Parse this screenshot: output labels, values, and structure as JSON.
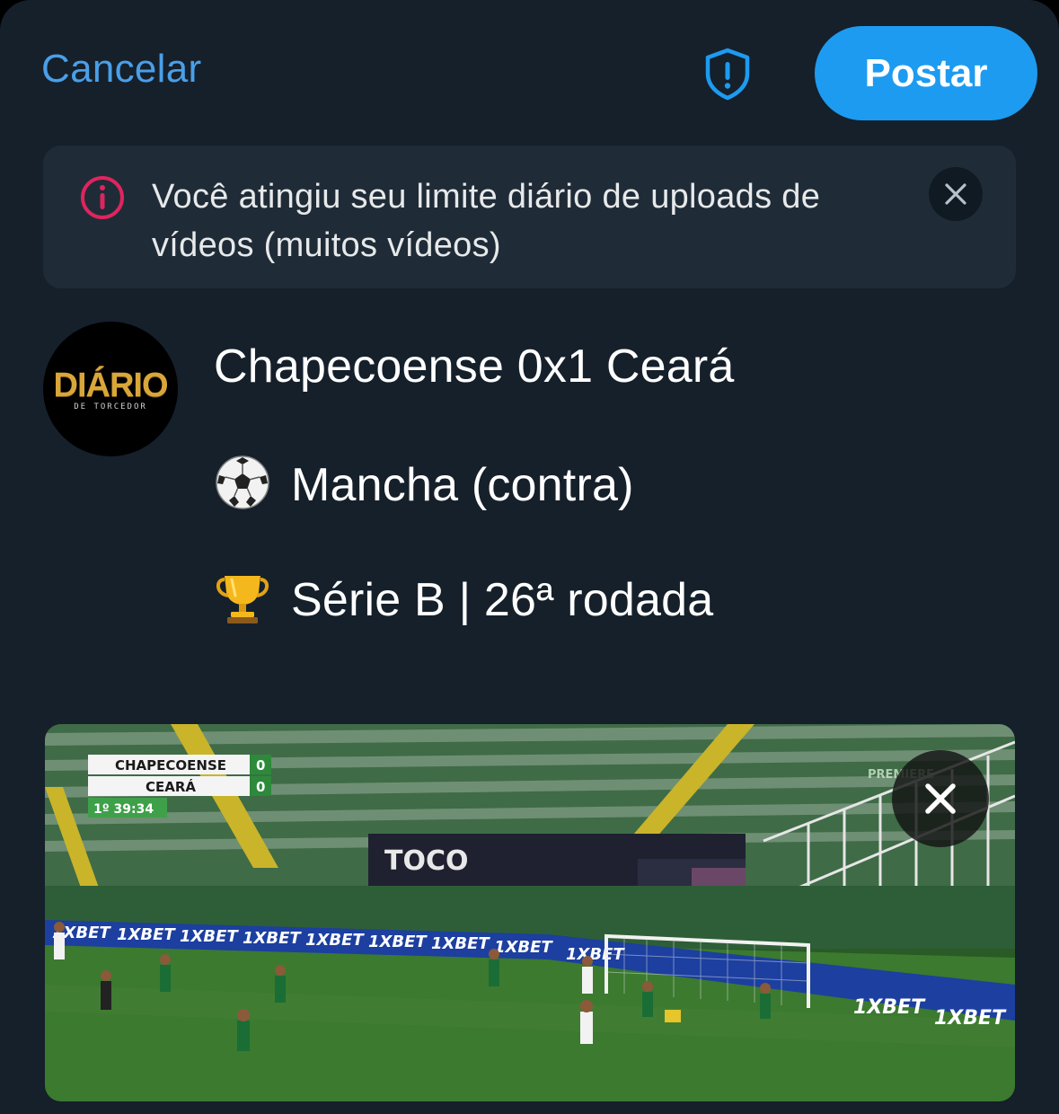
{
  "header": {
    "cancel_label": "Cancelar",
    "post_label": "Postar"
  },
  "banner": {
    "message": "Você atingiu seu limite diário de uploads de vídeos (muitos vídeos)"
  },
  "avatar": {
    "logo_text": "DIÁRIO",
    "logo_sub": "DE TORCEDOR"
  },
  "post": {
    "line1": "Chapecoense 0x1 Ceará",
    "line2": "Mancha (contra)",
    "line3": "Série B | 26ª rodada",
    "line2_icon": "soccer-ball-icon",
    "line3_icon": "trophy-icon"
  },
  "media": {
    "scoreboard": {
      "home_team": "CHAPECOENSE",
      "home_score": "0",
      "away_team": "CEARÁ",
      "away_score": "0",
      "clock": "1º 39:34"
    },
    "board_text": "1XBET",
    "banner_text": "TOCO",
    "broadcaster": "PREMIERE"
  },
  "colors": {
    "accent": "#1d9bf0",
    "link": "#4a9fe8",
    "background": "#15202b",
    "warning": "#e0245e"
  }
}
